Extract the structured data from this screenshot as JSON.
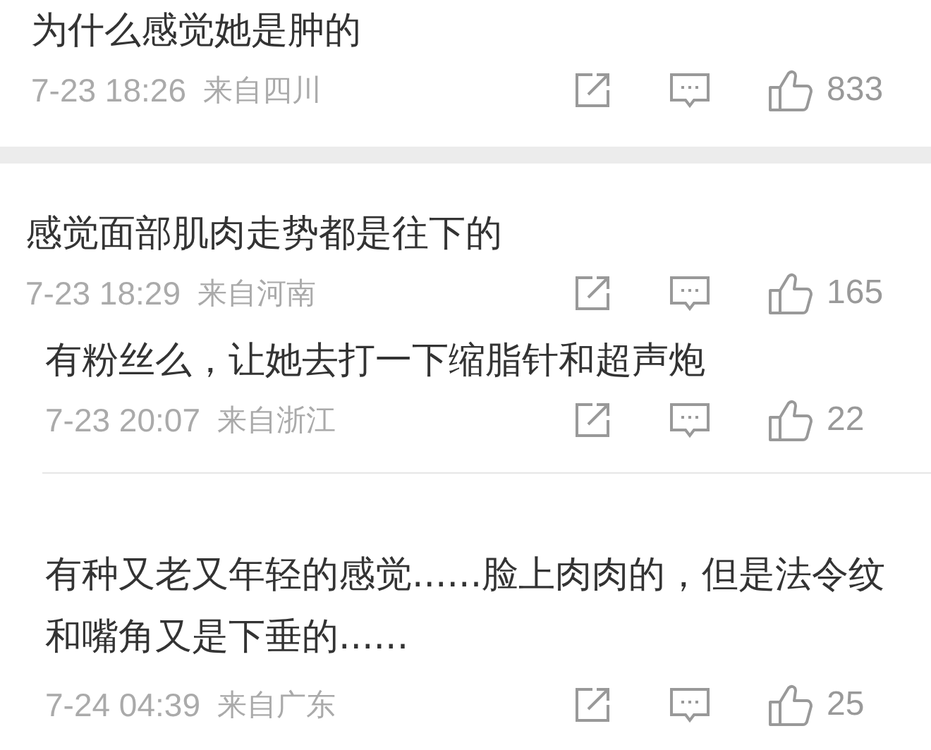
{
  "comments": [
    {
      "text": "为什么感觉她是肿的",
      "time": "7-23 18:26",
      "location": "来自四川",
      "likes": "833"
    },
    {
      "text": "感觉面部肌肉走势都是往下的",
      "time": "7-23 18:29",
      "location": "来自河南",
      "likes": "165"
    },
    {
      "text": "有粉丝么，让她去打一下缩脂针和超声炮",
      "time": "7-23 20:07",
      "location": "来自浙江",
      "likes": "22"
    },
    {
      "text": "有种又老又年轻的感觉......脸上肉肉的，但是法令纹和嘴角又是下垂的......",
      "time": "7-24 04:39",
      "location": "来自广东",
      "likes": "25"
    }
  ]
}
